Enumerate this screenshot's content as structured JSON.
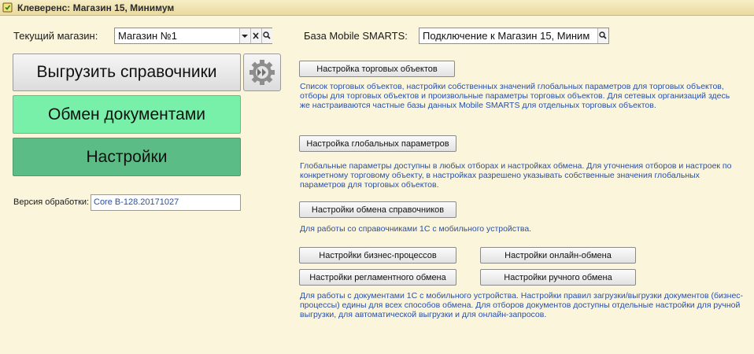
{
  "window": {
    "title": "Клеверенс: Магазин 15, Минимум"
  },
  "store": {
    "label": "Текущий магазин:",
    "value": "Магазин №1"
  },
  "base": {
    "label": "База Mobile SMARTS:",
    "value": "Подключение к Магазин 15, Миним"
  },
  "buttons": {
    "export": "Выгрузить справочники",
    "exchange": "Обмен документами",
    "settings": "Настройки",
    "trade_objects": "Настройка торговых объектов",
    "global_params": "Настройка глобальных параметров",
    "catalog_exchange": "Настройки обмена справочников",
    "business_processes": "Настройки бизнес-процессов",
    "online_exchange": "Настройки онлайн-обмена",
    "scheduled_exchange": "Настройки регламентного обмена",
    "manual_exchange": "Настройки ручного обмена"
  },
  "descriptions": {
    "trade_objects": "Список торговых объектов, настройки собственных значений глобальных параметров для торговых объектов, отборы для торговых объектов и произвольные параметры торговых объектов. Для сетевых организаций здесь же настраиваются частные базы данных Mobile SMARTS для отдельных торговых объектов.",
    "global_params": "Глобальные параметры доступны в любых отборах и настройках обмена. Для уточнения отборов и настроек по конкретному торговому объекту, в настройках разрешено указывать собственные значения глобальных параметров для торговых объектов.",
    "catalog_exchange": "Для работы со справочниками 1С с мобильного устройства.",
    "documents": "Для работы с документами 1С с мобильного устройства. Настройки правил загрузки/выгрузки документов (бизнес-процессы) едины для всех способов обмена. Для отборов документов доступны отдельные настройки для ручной выгрузки, для автоматической выгрузки и для онлайн-запросов."
  },
  "version": {
    "label": "Версия обработки:",
    "value": "Core B-128.20171027"
  },
  "icons": [
    "window-icon",
    "dropdown-arrow-icon",
    "clear-icon",
    "search-icon",
    "gear-arrows-icon"
  ],
  "colors": {
    "background": "#fbf5dc",
    "exchange_button": "#78f0aa",
    "settings_button": "#5bbd85",
    "link_text": "#2850a8"
  }
}
